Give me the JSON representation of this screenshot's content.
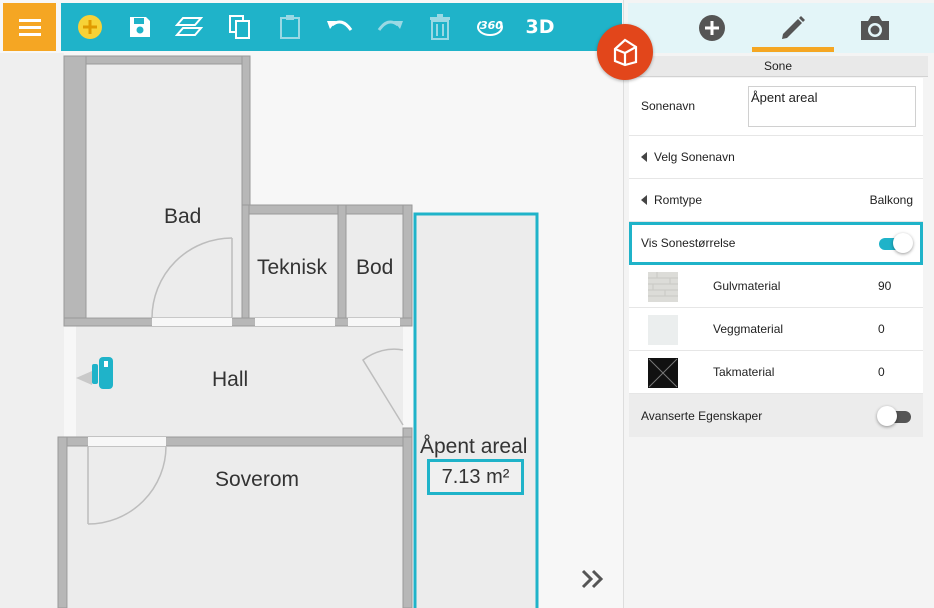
{
  "toolbar": {
    "icons": [
      "hamburger-icon",
      "add-icon",
      "save-icon",
      "layers-icon",
      "copy-icon",
      "paste-icon",
      "undo-icon",
      "redo-icon",
      "delete-icon",
      "view-360-icon",
      "view-3d-icon"
    ],
    "view_360_label": "360",
    "view_3d_label": "3D"
  },
  "floor_plan": {
    "rooms": {
      "bad": "Bad",
      "teknisk": "Teknisk",
      "bod": "Bod",
      "hall": "Hall",
      "soverom": "Soverom",
      "open_area": "Åpent areal"
    },
    "selected_zone_area": "7.13 m²"
  },
  "panel": {
    "tabs": [
      "add-icon",
      "edit-icon",
      "camera-icon"
    ],
    "active_tab": "edit",
    "title": "Sone",
    "zone_name_label": "Sonenavn",
    "zone_name_value": "Åpent areal",
    "choose_name_label": "Velg Sonenavn",
    "room_type_label": "Romtype",
    "room_type_value": "Balkong",
    "show_size_label": "Vis Sonestørrelse",
    "show_size_on": true,
    "materials": [
      {
        "label": "Gulvmaterial",
        "value": "90"
      },
      {
        "label": "Veggmaterial",
        "value": "0"
      },
      {
        "label": "Takmaterial",
        "value": "0"
      }
    ],
    "advanced_label": "Avanserte Egenskaper",
    "advanced_on": false
  },
  "colors": {
    "accent": "#1fb3c9",
    "menu": "#f5a623",
    "badge": "#e2461b"
  }
}
